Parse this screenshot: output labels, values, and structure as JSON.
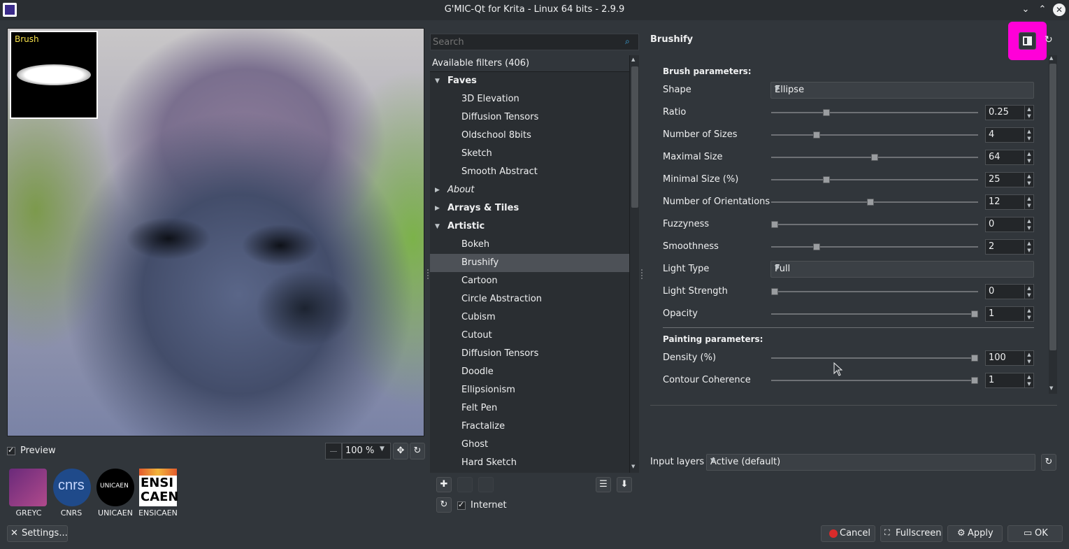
{
  "window": {
    "title": "G'MIC-Qt for Krita - Linux 64 bits - 2.9.9"
  },
  "preview": {
    "brush_label": "Brush",
    "checkbox_label": "Preview",
    "checked": true,
    "zoom": "100 %"
  },
  "logos": [
    "GREYC",
    "CNRS",
    "UNICAEN",
    "ENSICAEN"
  ],
  "logo_text": {
    "cnrs": "cnrs",
    "unicaen": "UNICAEN",
    "ensicaen_1": "ENSI",
    "ensicaen_2": "CAEN"
  },
  "settings_button": "Settings...",
  "search": {
    "placeholder": "Search"
  },
  "tree": {
    "header": "Available filters (406)",
    "rows": [
      {
        "label": "Faves",
        "kind": "cat",
        "expanded": true
      },
      {
        "label": "3D Elevation",
        "kind": "item"
      },
      {
        "label": "Diffusion Tensors",
        "kind": "item"
      },
      {
        "label": "Oldschool 8bits",
        "kind": "item"
      },
      {
        "label": "Sketch",
        "kind": "item"
      },
      {
        "label": "Smooth Abstract",
        "kind": "item"
      },
      {
        "label": "About",
        "kind": "cat-italic",
        "expanded": false
      },
      {
        "label": "Arrays & Tiles",
        "kind": "cat",
        "expanded": false
      },
      {
        "label": "Artistic",
        "kind": "cat",
        "expanded": true
      },
      {
        "label": "Bokeh",
        "kind": "item"
      },
      {
        "label": "Brushify",
        "kind": "item",
        "selected": true
      },
      {
        "label": "Cartoon",
        "kind": "item"
      },
      {
        "label": "Circle Abstraction",
        "kind": "item"
      },
      {
        "label": "Cubism",
        "kind": "item"
      },
      {
        "label": "Cutout",
        "kind": "item"
      },
      {
        "label": "Diffusion Tensors",
        "kind": "item"
      },
      {
        "label": "Doodle",
        "kind": "item"
      },
      {
        "label": "Ellipsionism",
        "kind": "item"
      },
      {
        "label": "Felt Pen",
        "kind": "item"
      },
      {
        "label": "Fractalize",
        "kind": "item"
      },
      {
        "label": "Ghost",
        "kind": "item"
      },
      {
        "label": "Hard Sketch",
        "kind": "item"
      }
    ]
  },
  "internet": {
    "label": "Internet",
    "checked": true
  },
  "filter": {
    "name": "Brushify",
    "section1": "Brush parameters:",
    "section2": "Painting parameters:",
    "params": [
      {
        "label": "Shape",
        "type": "combo",
        "value": "Ellipse"
      },
      {
        "label": "Ratio",
        "type": "slider",
        "value": "0.25",
        "fraction": 0.26
      },
      {
        "label": "Number of Sizes",
        "type": "slider",
        "value": "4",
        "fraction": 0.21
      },
      {
        "label": "Maximal Size",
        "type": "slider",
        "value": "64",
        "fraction": 0.5
      },
      {
        "label": "Minimal Size (%)",
        "type": "slider",
        "value": "25",
        "fraction": 0.26
      },
      {
        "label": "Number of Orientations",
        "type": "slider",
        "value": "12",
        "fraction": 0.48
      },
      {
        "label": "Fuzzyness",
        "type": "slider",
        "value": "0",
        "fraction": 0.0
      },
      {
        "label": "Smoothness",
        "type": "slider",
        "value": "2",
        "fraction": 0.21
      },
      {
        "label": "Light Type",
        "type": "combo",
        "value": "Full"
      },
      {
        "label": "Light Strength",
        "type": "slider",
        "value": "0",
        "fraction": 0.0
      },
      {
        "label": "Opacity",
        "type": "slider",
        "value": "1",
        "fraction": 1.0
      }
    ],
    "params2": [
      {
        "label": "Density (%)",
        "type": "slider",
        "value": "100",
        "fraction": 1.0
      },
      {
        "label": "Contour Coherence",
        "type": "slider",
        "value": "1",
        "fraction": 1.0
      }
    ]
  },
  "input_layers": {
    "label": "Input layers",
    "value": "Active (default)"
  },
  "buttons": {
    "cancel": "Cancel",
    "fullscreen": "Fullscreen",
    "apply": "Apply",
    "ok": "OK"
  },
  "colors": {
    "highlight": "#ff00d8",
    "background": "#31363b",
    "selected_row": "#4d5157"
  }
}
